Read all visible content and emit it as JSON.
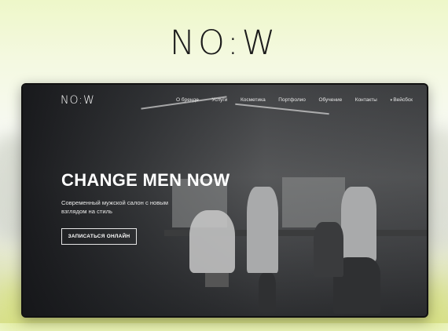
{
  "brand": {
    "logo": "NO:W"
  },
  "site": {
    "logo": "NO:W",
    "nav": [
      {
        "label": "О бренде"
      },
      {
        "label": "Услуги"
      },
      {
        "label": "Косметика"
      },
      {
        "label": "Портфолио"
      },
      {
        "label": "Обучение"
      },
      {
        "label": "Контакты"
      },
      {
        "label": "Вейсбск"
      }
    ],
    "hero": {
      "headline": "CHANGE MEN NOW",
      "subtitle": "Современный мужской салон с новым взглядом на стиль",
      "cta_label": "ЗАПИСАТЬСЯ ОНЛАЙН"
    }
  },
  "colors": {
    "accent_lime": "#d6e07c",
    "dark_frame": "#1b1c1d"
  }
}
